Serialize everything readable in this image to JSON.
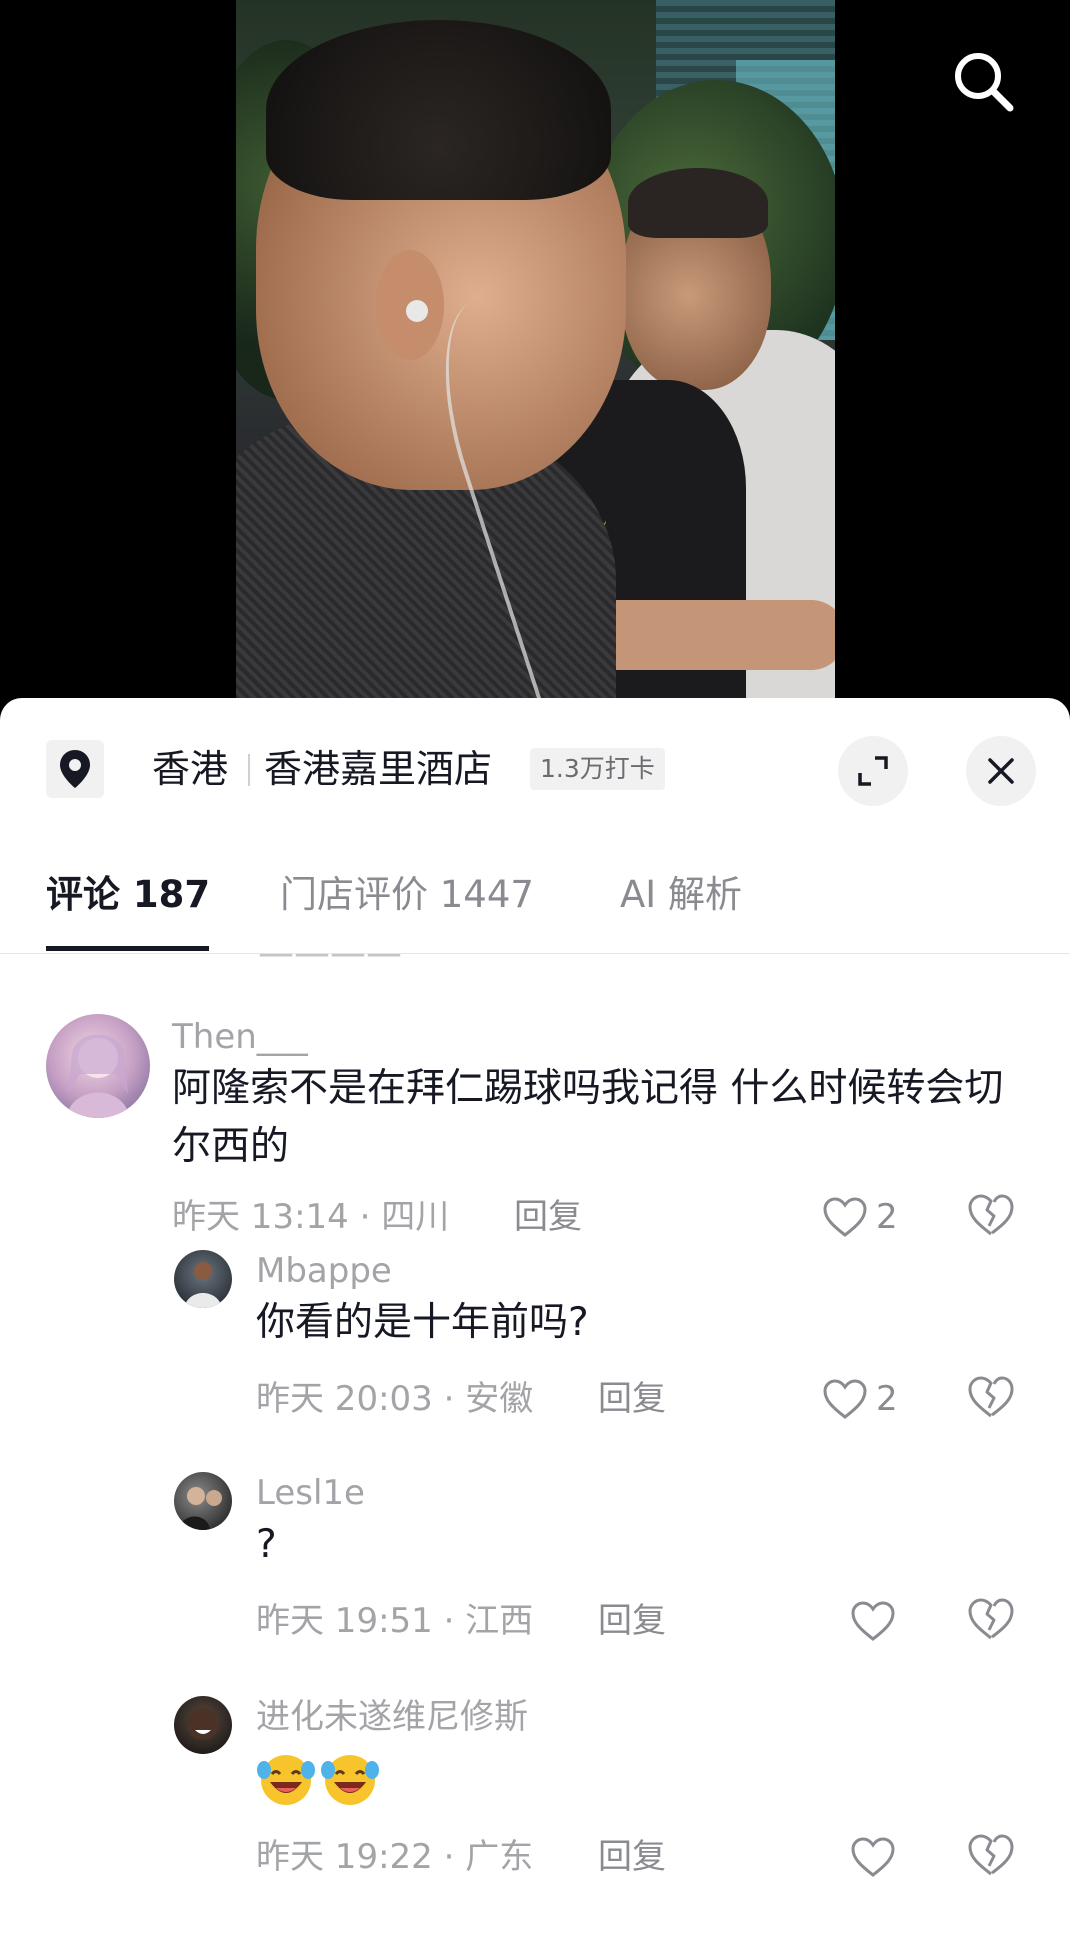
{
  "location": {
    "city": "香港",
    "place": "香港嘉里酒店",
    "checkins": "1.3万打卡"
  },
  "tabs": [
    {
      "label": "评论 187"
    },
    {
      "label": "门店评价 1447"
    },
    {
      "label": "AI 解析"
    }
  ],
  "comments": [
    {
      "username": "Then___",
      "text": "阿隆索不是在拜仁踢球吗我记得 什么时候转会切尔西的",
      "time": "昨天 13:14 · 四川",
      "reply_label": "回复",
      "likes": "2"
    },
    {
      "username": "Mbappe",
      "text": "你看的是十年前吗?",
      "time": "昨天 20:03 · 安徽",
      "reply_label": "回复",
      "likes": "2"
    },
    {
      "username": "Lesl1e",
      "text": "?",
      "time": "昨天 19:51 · 江西",
      "reply_label": "回复"
    },
    {
      "username": "进化未遂维尼修斯",
      "emojis": [
        "laughing-crying-emoji",
        "laughing-crying-emoji"
      ],
      "time": "昨天 19:22 · 广东",
      "reply_label": "回复"
    }
  ],
  "icons": [
    "search-icon",
    "location-pin-icon",
    "expand-icon",
    "close-icon",
    "heart-icon",
    "broken-heart-icon"
  ]
}
